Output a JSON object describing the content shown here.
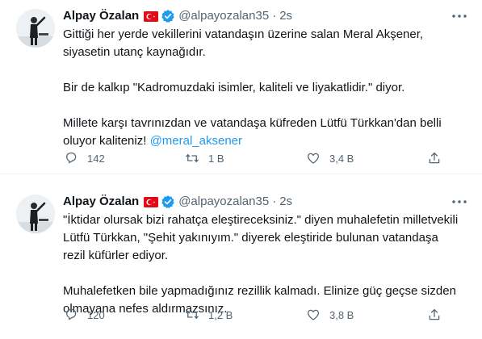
{
  "tweets": [
    {
      "author": {
        "name": "Alpay Özalan",
        "handle": "@alpayozalan35"
      },
      "time": "2s",
      "dot": "·",
      "paragraphs": [
        "Gittiği her yerde vekillerini vatandaşın üzerine salan Meral Akşener, siyasetin utanç kaynağıdır.",
        "Bir de kalkıp \"Kadromuzdaki isimler, kaliteli ve liyakatlidir.\" diyor."
      ],
      "last_paragraph_text": "Millete karşı tavrınızdan ve vatandaşa küfreden Lütfü Türkkan'dan belli oluyor kaliteniz! ",
      "mention": "@meral_aksener",
      "stats": {
        "replies": "142",
        "retweets": "1 B",
        "likes": "3,4 B"
      }
    },
    {
      "author": {
        "name": "Alpay Özalan",
        "handle": "@alpayozalan35"
      },
      "time": "2s",
      "dot": "·",
      "paragraphs": [
        "\"İktidar olursak bizi rahatça eleştireceksiniz.\" diyen muhalefetin milletvekili Lütfü Türkkan, \"Şehit yakınıyım.\" diyerek eleştiride bulunan vatandaşa rezil küfürler ediyor.",
        "Muhalefetken bile yapmadığınız rezillik kalmadı. Elinize güç geçse sizden olmayana nefes aldırmazsınız."
      ],
      "stats": {
        "replies": "120",
        "retweets": "1,2 B",
        "likes": "3,8 B"
      }
    }
  ],
  "icons": {
    "flag": "turkey-flag-icon",
    "verified": "verified-badge-icon",
    "more": "more-options-icon",
    "reply": "reply-icon",
    "retweet": "retweet-icon",
    "like": "like-icon",
    "share": "share-icon"
  },
  "colors": {
    "text": "#0f1419",
    "secondary": "#536471",
    "link": "#1d9bf0",
    "verified": "#1d9bf0",
    "flag": "#e30a17",
    "divider": "#eff3f4"
  }
}
